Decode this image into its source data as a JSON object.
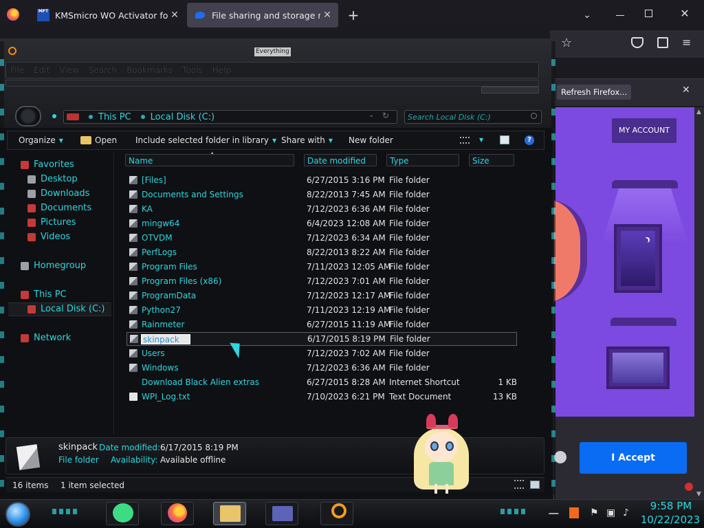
{
  "browser": {
    "tabs": [
      {
        "label": "KMSmicro WO Activator for offi",
        "favicon": "MFT"
      },
      {
        "label": "File sharing and storage made s",
        "favicon": "cloud"
      }
    ],
    "new_tab": "+",
    "tab_close": "✕",
    "tab_list": "⌄",
    "star": "☆",
    "menu": "≡",
    "notice_button": "Refresh Firefox...",
    "notice_close": "✕",
    "page": {
      "my_account": "MY ACCOUNT",
      "accept_button": "I Accept"
    }
  },
  "explorer": {
    "title": "Everything",
    "menu": [
      "File",
      "Edit",
      "View",
      "Search",
      "Bookmarks",
      "Tools",
      "Help"
    ],
    "address": {
      "crumbs": [
        "This PC",
        "Local Disk (C:)"
      ],
      "drop": "⌄",
      "refresh": "↻"
    },
    "search_placeholder": "Search Local Disk (C:)",
    "toolbar": {
      "organize": "Organize",
      "open": "Open",
      "include": "Include selected folder in library",
      "share": "Share with",
      "new_folder": "New folder",
      "help": "?",
      "arrow": "▼"
    },
    "nav": {
      "favorites": "Favorites",
      "desktop": "Desktop",
      "downloads": "Downloads",
      "documents": "Documents",
      "pictures": "Pictures",
      "videos": "Videos",
      "homegroup": "Homegroup",
      "this_pc": "This PC",
      "local_disk": "Local Disk (C:)",
      "network": "Network"
    },
    "columns": {
      "name": "Name",
      "date": "Date modified",
      "type": "Type",
      "size": "Size"
    },
    "files": [
      {
        "name": "[Files]",
        "date": "6/27/2015 3:16 PM",
        "type": "File folder",
        "size": ""
      },
      {
        "name": "Documents and Settings",
        "date": "8/22/2013 7:45 AM",
        "type": "File folder",
        "size": ""
      },
      {
        "name": "KA",
        "date": "7/12/2023 6:36 AM",
        "type": "File folder",
        "size": ""
      },
      {
        "name": "mingw64",
        "date": "6/4/2023 12:08 AM",
        "type": "File folder",
        "size": ""
      },
      {
        "name": "OTVDM",
        "date": "7/12/2023 6:34 AM",
        "type": "File folder",
        "size": ""
      },
      {
        "name": "PerfLogs",
        "date": "8/22/2013 8:22 AM",
        "type": "File folder",
        "size": ""
      },
      {
        "name": "Program Files",
        "date": "7/11/2023 12:05 AM",
        "type": "File folder",
        "size": ""
      },
      {
        "name": "Program Files (x86)",
        "date": "7/12/2023 7:01 AM",
        "type": "File folder",
        "size": ""
      },
      {
        "name": "ProgramData",
        "date": "7/12/2023 12:17 AM",
        "type": "File folder",
        "size": ""
      },
      {
        "name": "Python27",
        "date": "7/11/2023 12:19 AM",
        "type": "File folder",
        "size": ""
      },
      {
        "name": "Rainmeter",
        "date": "6/27/2015 11:19 AM",
        "type": "File folder",
        "size": ""
      },
      {
        "name": "skinpack",
        "date": "6/17/2015 8:19 PM",
        "type": "File folder",
        "size": ""
      },
      {
        "name": "Users",
        "date": "7/12/2023 7:02 AM",
        "type": "File folder",
        "size": ""
      },
      {
        "name": "Windows",
        "date": "7/12/2023 6:36 AM",
        "type": "File folder",
        "size": ""
      },
      {
        "name": "Download Black Alien extras",
        "date": "6/27/2015 8:28 AM",
        "type": "Internet Shortcut",
        "size": "1 KB"
      },
      {
        "name": "WPI_Log.txt",
        "date": "7/10/2023 6:21 PM",
        "type": "Text Document",
        "size": "13 KB"
      }
    ],
    "details": {
      "name": "skinpack",
      "date_label": "Date modified:",
      "date_value": "6/17/2015 8:19 PM",
      "type_value": "File folder",
      "availability_label": "Availability:",
      "availability_value": "Available offline"
    },
    "status": {
      "count": "16 items",
      "selected": "1 item selected"
    }
  },
  "taskbar": {
    "time": "9:58 PM",
    "date": "10/22/2023"
  }
}
